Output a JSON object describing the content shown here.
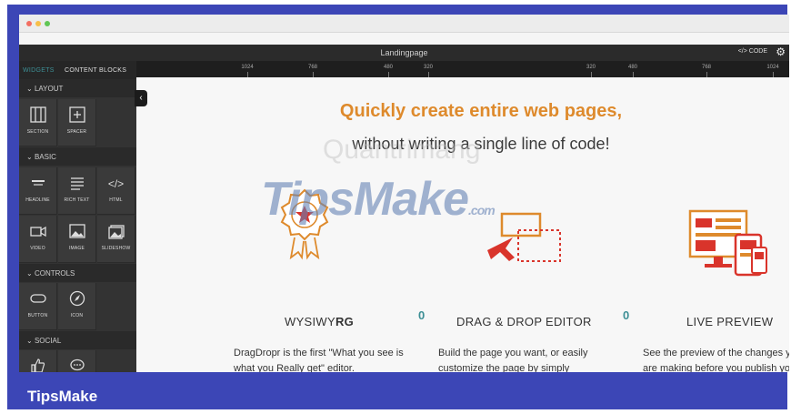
{
  "app": {
    "page_title": "Landingpage",
    "code_label": "CODE",
    "code_icon": "code-brackets-icon",
    "settings_icon": "gear-icon"
  },
  "panel_tabs": [
    "WIDGETS",
    "CONTENT BLOCKS"
  ],
  "ruler": [
    "1024",
    "768",
    "480",
    "320",
    "320",
    "480",
    "768",
    "1024"
  ],
  "sidebar": {
    "sections": [
      {
        "title": "LAYOUT",
        "items": [
          {
            "label": "SECTION",
            "icon": "section-columns-icon"
          },
          {
            "label": "SPACER",
            "icon": "spacer-icon"
          }
        ]
      },
      {
        "title": "BASIC",
        "items": [
          {
            "label": "HEADLINE",
            "icon": "headline-icon"
          },
          {
            "label": "RICH TEXT",
            "icon": "rich-text-icon"
          },
          {
            "label": "HTML",
            "icon": "html-code-icon"
          },
          {
            "label": "VIDEO",
            "icon": "video-camera-icon"
          },
          {
            "label": "IMAGE",
            "icon": "image-icon"
          },
          {
            "label": "SLIDESHOW",
            "icon": "slideshow-icon"
          }
        ]
      },
      {
        "title": "CONTROLS",
        "items": [
          {
            "label": "BUTTON",
            "icon": "button-icon"
          },
          {
            "label": "ICON",
            "icon": "compass-icon"
          }
        ]
      },
      {
        "title": "SOCIAL",
        "items": [
          {
            "label": "",
            "icon": "thumbs-up-icon"
          },
          {
            "label": "",
            "icon": "chat-bubble-icon"
          }
        ]
      }
    ]
  },
  "hero": {
    "line1": "Quickly create entire web pages,",
    "line2": "without writing a single line of code!"
  },
  "features": [
    {
      "title_main": "WYSIWY",
      "title_bold": "RG",
      "desc1": "DragDropr is the first \"What you see is",
      "desc2": "what you Really get\" editor.",
      "icon": "award-ribbon-icon"
    },
    {
      "title": "DRAG & DROP EDITOR",
      "desc1": "Build the page you want, or easily",
      "desc2": "customize the page by simply",
      "icon": "drag-drop-cursor-icon"
    },
    {
      "title": "LIVE PREVIEW",
      "desc1": "See the preview of the changes you",
      "desc2": "are making before you publish your",
      "icon": "responsive-devices-icon"
    }
  ],
  "watermark": {
    "brand": "TipsMake",
    "suffix": ".com",
    "secondary": "Quantrimang"
  },
  "footer": {
    "brand": "TipsMake"
  },
  "colors": {
    "accent_orange": "#de8a2c",
    "frame_blue": "#3c46b6",
    "feature_red": "#d9342b",
    "spinner_teal": "#3d8f95"
  }
}
